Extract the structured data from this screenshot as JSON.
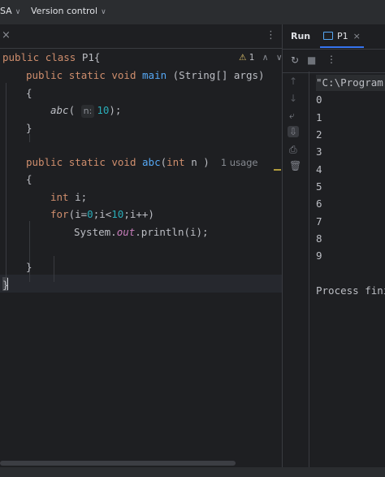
{
  "toolbar": {
    "project_label": "SA",
    "vcs_label": "Version control"
  },
  "editor": {
    "warning_count": "1",
    "line1": {
      "kw1": "public",
      "kw2": "class",
      "name": "P1{"
    },
    "line2": {
      "kw1": "public",
      "kw2": "static",
      "kw3": "void",
      "name": "main",
      "rest": " (String[] args)"
    },
    "line3": "{",
    "line4": {
      "call": "abc",
      "open": "(",
      "hint": "n:",
      "num": "10",
      "close": ");"
    },
    "line5": "}",
    "line7": {
      "kw1": "public",
      "kw2": "static",
      "kw3": "void",
      "name": "abc",
      "open": "(",
      "kw4": "int",
      "param": " n ",
      "close": ")",
      "usage": "1 usage"
    },
    "line8": "{",
    "line9": {
      "kw": "int",
      "rest": " i;"
    },
    "line10": {
      "kw": "for",
      "p1": "(i=",
      "n1": "0",
      "p2": ";i<",
      "n2": "10",
      "p3": ";i++)"
    },
    "line11": {
      "p1": "System.",
      "field": "out",
      "p2": ".println(i);"
    },
    "line13": "}",
    "line14": "}"
  },
  "run": {
    "title": "Run",
    "tab_label": "P1",
    "console_lines": [
      "\"C:\\Program",
      "0",
      "1",
      "2",
      "3",
      "4",
      "5",
      "6",
      "7",
      "8",
      "9",
      "",
      "Process fini"
    ]
  }
}
